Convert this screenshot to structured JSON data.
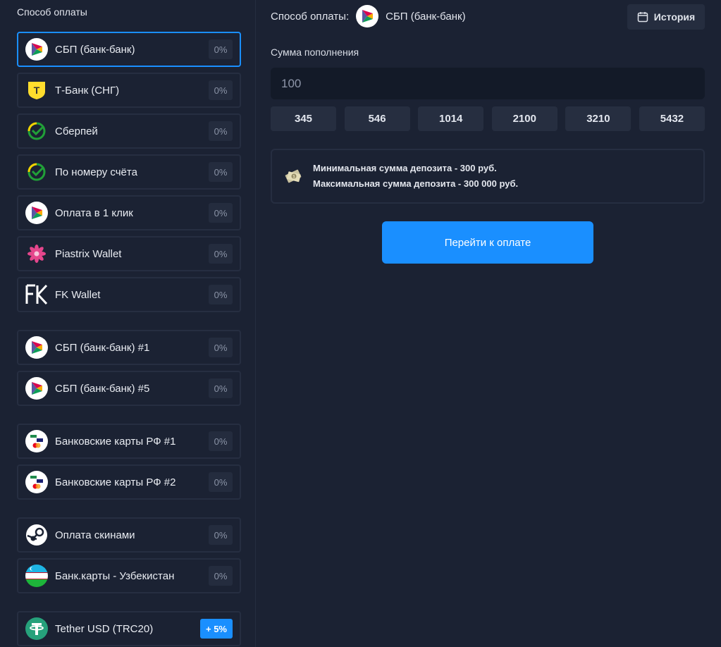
{
  "sidebar": {
    "title": "Способ оплаты",
    "methods": [
      {
        "label": "СБП (банк-банк)",
        "badge": "0%",
        "icon": "sbp-icon",
        "selected": true
      },
      {
        "label": "Т-Банк (СНГ)",
        "badge": "0%",
        "icon": "tbank-icon"
      },
      {
        "label": "Сберпей",
        "badge": "0%",
        "icon": "sber-icon"
      },
      {
        "label": "По номеру счёта",
        "badge": "0%",
        "icon": "sber-icon"
      },
      {
        "label": "Оплата в 1 клик",
        "badge": "0%",
        "icon": "sbp-icon"
      },
      {
        "label": "Piastrix Wallet",
        "badge": "0%",
        "icon": "piastrix-flower-icon"
      },
      {
        "label": "FK Wallet",
        "badge": "0%",
        "icon": "fk-logo-icon"
      },
      {
        "label": "СБП (банк-банк) #1",
        "badge": "0%",
        "icon": "sbp-icon"
      },
      {
        "label": "СБП (банк-банк) #5",
        "badge": "0%",
        "icon": "sbp-icon"
      },
      {
        "label": "Банковские карты РФ #1",
        "badge": "0%",
        "icon": "card-brands-icon"
      },
      {
        "label": "Банковские карты РФ #2",
        "badge": "0%",
        "icon": "card-brands-icon"
      },
      {
        "label": "Оплата скинами",
        "badge": "0%",
        "icon": "steam-icon"
      },
      {
        "label": "Банк.карты - Узбекистан",
        "badge": "0%",
        "icon": "uzbekistan-flag-icon"
      },
      {
        "label": "Tether USD (TRC20)",
        "badge": "+ 5%",
        "icon": "tether-icon"
      }
    ]
  },
  "header": {
    "prefix": "Способ оплаты:",
    "selected_method": "СБП (банк-банк)",
    "history_label": "История"
  },
  "amount": {
    "label": "Сумма пополнения",
    "value": "100",
    "presets": [
      "345",
      "546",
      "1014",
      "2100",
      "3210",
      "5432"
    ]
  },
  "info": {
    "min_line": "Минимальная сумма депозита - 300 руб.",
    "max_line": "Максимальная сумма депозита - 300 000 руб."
  },
  "pay_button_label": "Перейти к оплате",
  "colors": {
    "background": "#1b2233",
    "accent": "#1a8fff",
    "border": "#262e41"
  }
}
